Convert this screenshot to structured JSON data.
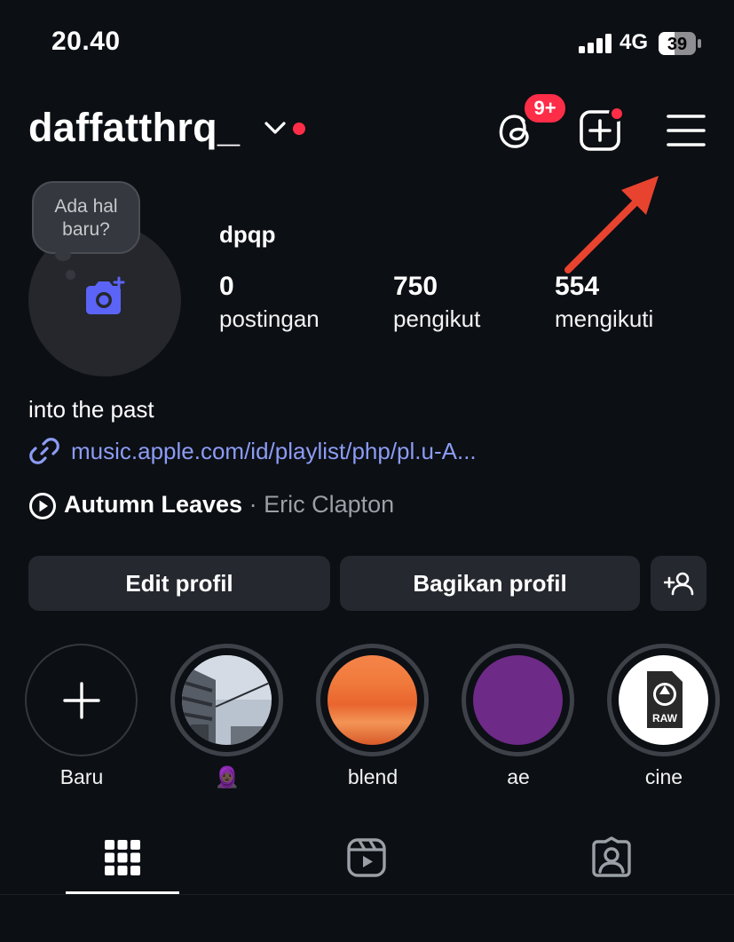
{
  "status_bar": {
    "time": "20.40",
    "network": "4G",
    "battery": "39"
  },
  "header": {
    "username": "daffatthrq_",
    "threads_badge": "9+"
  },
  "avatar": {
    "bubble_text": "Ada hal baru?"
  },
  "profile": {
    "display_name": "dpqp",
    "stats": [
      {
        "value": "0",
        "label": "postingan"
      },
      {
        "value": "750",
        "label": "pengikut"
      },
      {
        "value": "554",
        "label": "mengikuti"
      }
    ],
    "bio": "into the past",
    "link": "music.apple.com/id/playlist/php/pl.u-A...",
    "song": {
      "title": "Autumn Leaves",
      "separator": "·",
      "artist": "Eric Clapton"
    }
  },
  "buttons": {
    "edit": "Edit profil",
    "share": "Bagikan profil"
  },
  "highlights": [
    {
      "label": "Baru"
    },
    {
      "label": "🧕🏿"
    },
    {
      "label": "blend"
    },
    {
      "label": "ae"
    },
    {
      "label": "cine"
    }
  ],
  "tabs": [
    "grid",
    "reels",
    "tagged"
  ],
  "colors": {
    "background": "#0c0f14",
    "accent_red": "#ff2d47",
    "link": "#8c9cf4",
    "button_bg": "#25282e",
    "camera_blue": "#5b64f7"
  }
}
